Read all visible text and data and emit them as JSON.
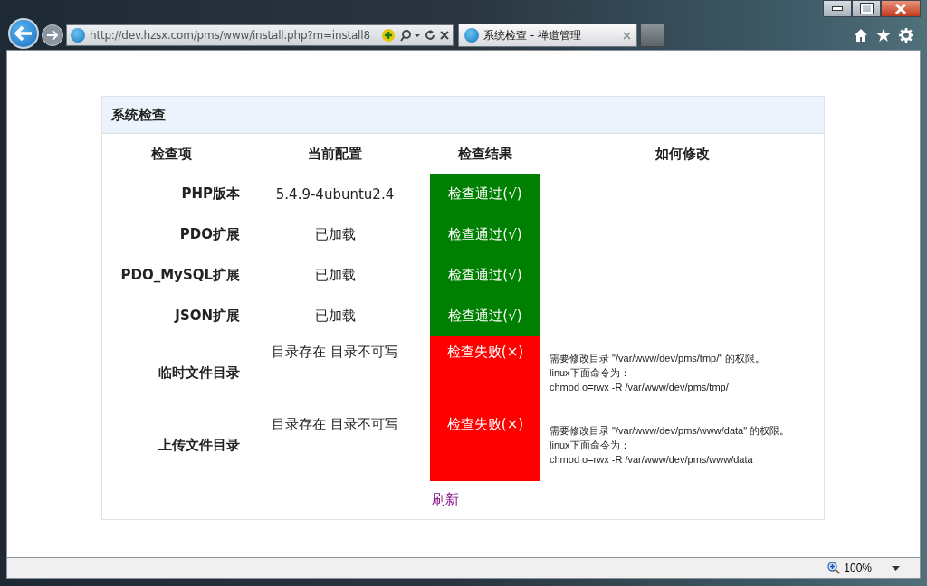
{
  "browser": {
    "address": "http://dev.hzsx.com/pms/www/install.php?m=install8",
    "tab_title": "系统检查 - 禅道管理",
    "zoom": "100%"
  },
  "panel": {
    "title": "系统检查",
    "columns": [
      "检查项",
      "当前配置",
      "检查结果",
      "如何修改"
    ],
    "rows": [
      {
        "item": "PHP版本",
        "config": "5.4.9-4ubuntu2.4",
        "result": "检查通过(√)",
        "passed": true,
        "fix": []
      },
      {
        "item": "PDO扩展",
        "config": "已加载",
        "result": "检查通过(√)",
        "passed": true,
        "fix": []
      },
      {
        "item": "PDO_MySQL扩展",
        "config": "已加载",
        "result": "检查通过(√)",
        "passed": true,
        "fix": []
      },
      {
        "item": "JSON扩展",
        "config": "已加载",
        "result": "检查通过(√)",
        "passed": true,
        "fix": []
      },
      {
        "item": "临时文件目录",
        "config": "目录存在 目录不可写",
        "result": "检查失败(×)",
        "passed": false,
        "fix": [
          "需要修改目录 \"/var/www/dev/pms/tmp/\" 的权限。",
          "linux下面命令为：",
          "chmod o=rwx -R /var/www/dev/pms/tmp/"
        ]
      },
      {
        "item": "上传文件目录",
        "config": "目录存在 目录不可写",
        "result": "检查失败(×)",
        "passed": false,
        "fix": [
          "需要修改目录 \"/var/www/dev/pms/www/data\" 的权限。",
          "linux下面命令为：",
          "chmod o=rwx -R /var/www/dev/pms/www/data"
        ]
      }
    ],
    "refresh": "刷新"
  }
}
